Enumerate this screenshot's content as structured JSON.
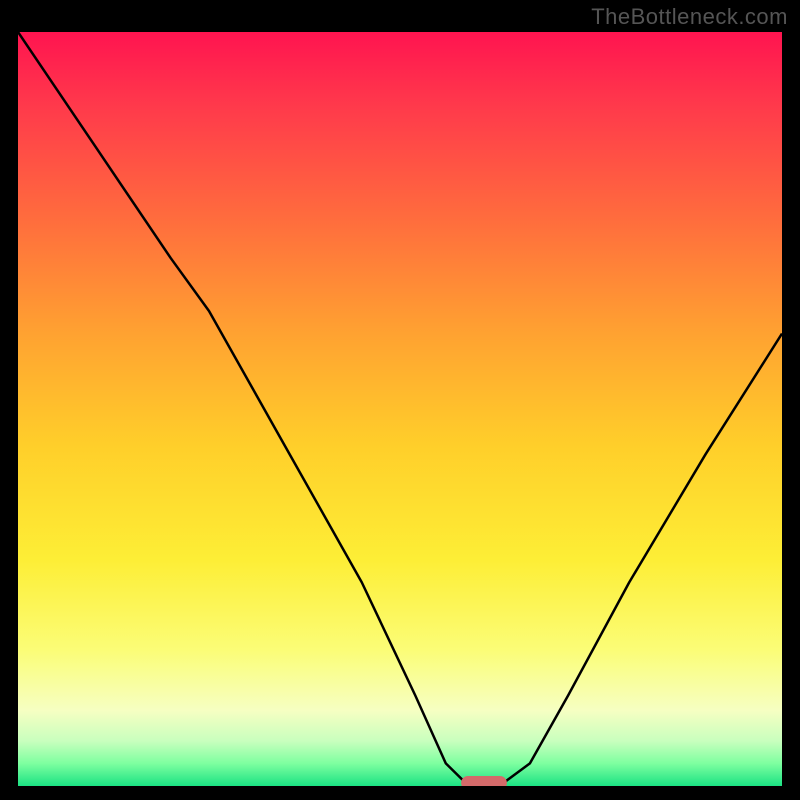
{
  "watermark": "TheBottleneck.com",
  "chart_data": {
    "type": "line",
    "title": "",
    "xlabel": "",
    "ylabel": "",
    "xlim": [
      0,
      100
    ],
    "ylim": [
      0,
      100
    ],
    "series": [
      {
        "name": "bottleneck-curve",
        "x": [
          0,
          10,
          20,
          25,
          35,
          45,
          52,
          56,
          59,
          63,
          67,
          72,
          80,
          90,
          100
        ],
        "values": [
          100,
          85,
          70,
          63,
          45,
          27,
          12,
          3,
          0,
          0,
          3,
          12,
          27,
          44,
          60
        ]
      }
    ],
    "optimal_marker": {
      "x": 61,
      "y": 0,
      "width": 6,
      "height": 2,
      "color": "#d46a6a"
    },
    "gradient_stops": [
      {
        "pos": 0,
        "color": "#ff1450"
      },
      {
        "pos": 10,
        "color": "#ff3a4b"
      },
      {
        "pos": 25,
        "color": "#ff6d3d"
      },
      {
        "pos": 40,
        "color": "#ffa231"
      },
      {
        "pos": 55,
        "color": "#ffcf2a"
      },
      {
        "pos": 70,
        "color": "#fdee36"
      },
      {
        "pos": 82,
        "color": "#fbfd77"
      },
      {
        "pos": 90,
        "color": "#f6ffc2"
      },
      {
        "pos": 94,
        "color": "#c9ffbe"
      },
      {
        "pos": 97,
        "color": "#7effa0"
      },
      {
        "pos": 100,
        "color": "#1be283"
      }
    ]
  }
}
